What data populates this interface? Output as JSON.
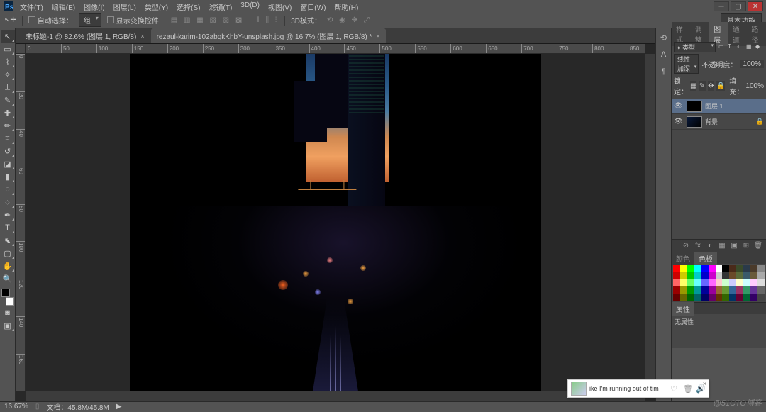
{
  "menu": {
    "items": [
      "文件(T)",
      "编辑(E)",
      "图像(I)",
      "图层(L)",
      "类型(Y)",
      "选择(S)",
      "滤镜(T)",
      "3D(D)",
      "视图(V)",
      "窗口(W)",
      "帮助(H)"
    ]
  },
  "options": {
    "autoSelect": "自动选择：",
    "autoSelectMode": "组",
    "showTransform": "显示变换控件",
    "workspace": "基本功能",
    "mode3d": "3D模式："
  },
  "tabs": [
    {
      "label": "未标题-1 @ 82.6% (图层 1, RGB/8)",
      "active": false
    },
    {
      "label": "rezaul-karim-102abqkKhbY-unsplash.jpg @ 16.7% (图层 1, RGB/8) *",
      "active": true
    }
  ],
  "tools": [
    {
      "name": "move-tool",
      "glyph": "↖",
      "active": true,
      "fly": true
    },
    {
      "name": "marquee-tool",
      "glyph": "▭",
      "fly": true
    },
    {
      "name": "lasso-tool",
      "glyph": "⌇",
      "fly": true
    },
    {
      "name": "magic-wand-tool",
      "glyph": "✧",
      "fly": true
    },
    {
      "name": "crop-tool",
      "glyph": "⟂",
      "fly": true
    },
    {
      "name": "eyedropper-tool",
      "glyph": "✎",
      "fly": true
    },
    {
      "name": "healing-brush-tool",
      "glyph": "✚",
      "fly": true
    },
    {
      "name": "brush-tool",
      "glyph": "✏",
      "fly": true
    },
    {
      "name": "clone-stamp-tool",
      "glyph": "⌑",
      "fly": true
    },
    {
      "name": "history-brush-tool",
      "glyph": "↺",
      "fly": true
    },
    {
      "name": "eraser-tool",
      "glyph": "◪",
      "fly": true
    },
    {
      "name": "gradient-tool",
      "glyph": "▮",
      "fly": true
    },
    {
      "name": "blur-tool",
      "glyph": "◌",
      "fly": true
    },
    {
      "name": "dodge-tool",
      "glyph": "☼",
      "fly": true
    },
    {
      "name": "pen-tool",
      "glyph": "✒",
      "fly": true
    },
    {
      "name": "type-tool",
      "glyph": "T",
      "fly": true
    },
    {
      "name": "path-select-tool",
      "glyph": "⬉",
      "fly": true
    },
    {
      "name": "shape-tool",
      "glyph": "▢",
      "fly": true
    },
    {
      "name": "hand-tool",
      "glyph": "✋",
      "fly": true
    },
    {
      "name": "zoom-tool",
      "glyph": "🔍"
    }
  ],
  "collapsedPanels": [
    {
      "name": "history-panel-icon",
      "glyph": "⟲"
    },
    {
      "name": "character-panel-icon",
      "glyph": "A"
    },
    {
      "name": "paragraph-panel-icon",
      "glyph": "¶"
    }
  ],
  "hRuler": [
    0,
    50,
    100,
    150,
    200,
    250,
    300,
    350,
    400,
    450,
    500,
    550,
    600,
    650,
    700,
    750,
    800,
    850
  ],
  "vRuler": [
    0,
    20,
    40,
    60,
    80,
    100,
    120,
    140,
    160
  ],
  "layersPanel": {
    "tabs": [
      "样式",
      "调整",
      "图层",
      "通道",
      "路径"
    ],
    "activeTab": 2,
    "kind": "♦ 类型",
    "filterIcons": [
      "▭",
      "T",
      "◐",
      "▦",
      "◆"
    ],
    "blend": "线性加深",
    "opacityLabel": "不透明度：",
    "opacity": "100%",
    "lockLabel": "锁定：",
    "fillLabel": "填充：",
    "fill": "100%",
    "layers": [
      {
        "name": "图层 1",
        "selected": true,
        "visible": true,
        "locked": false,
        "thumb": "solid"
      },
      {
        "name": "背景",
        "selected": false,
        "visible": true,
        "locked": true,
        "thumb": "img"
      }
    ],
    "footIcons": [
      "⊘",
      "fx",
      "◐",
      "▦",
      "▣",
      "⊞",
      "🗑"
    ]
  },
  "colorPanel": {
    "tabs": [
      "颜色",
      "色板"
    ],
    "activeTab": 1
  },
  "swatchColors": [
    [
      "#ff0000",
      "#ffff00",
      "#00ff00",
      "#00ffff",
      "#0000ff",
      "#ff00ff",
      "#ffffff",
      "#000000",
      "#4a2a1a",
      "#3a4a2a",
      "#2a3a4a",
      "#4a3a2a",
      "#888888"
    ],
    [
      "#cc0000",
      "#cccc00",
      "#00cc00",
      "#00cccc",
      "#0000cc",
      "#cc00cc",
      "#cccccc",
      "#333333",
      "#6a4a2a",
      "#5a6a3a",
      "#3a5a6a",
      "#6a5a3a",
      "#aaaaaa"
    ],
    [
      "#ff6666",
      "#ffff66",
      "#66ff66",
      "#66ffff",
      "#6666ff",
      "#ff66ff",
      "#ffcccc",
      "#ccffcc",
      "#ccccff",
      "#ffffcc",
      "#ccffff",
      "#ffccff",
      "#dddddd"
    ],
    [
      "#990000",
      "#999900",
      "#009900",
      "#009999",
      "#000099",
      "#990099",
      "#996633",
      "#669933",
      "#336699",
      "#993366",
      "#339966",
      "#663399",
      "#666666"
    ],
    [
      "#660000",
      "#666600",
      "#006600",
      "#006666",
      "#000066",
      "#660066",
      "#663300",
      "#336600",
      "#003366",
      "#660033",
      "#006633",
      "#330066",
      "#444444"
    ]
  ],
  "propsPanel": {
    "tab": "属性",
    "body": "无属性"
  },
  "status": {
    "zoom": "16.67%",
    "doc": "文档：45.8M/45.8M"
  },
  "notification": {
    "text": "ike I'm running out of tim"
  },
  "watermark": "@51CTO博客"
}
